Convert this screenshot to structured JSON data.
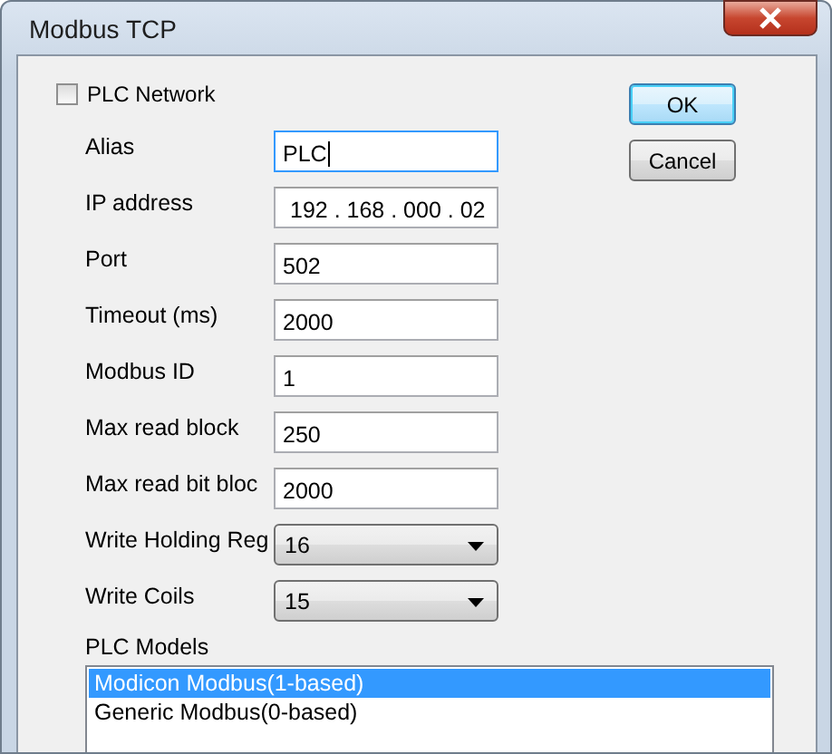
{
  "window": {
    "title": "Modbus TCP"
  },
  "plc_network": {
    "label": "PLC Network",
    "checked": false
  },
  "fields": [
    {
      "label": "Alias",
      "kind": "text",
      "value": "PLC",
      "focused": true
    },
    {
      "label": "IP address",
      "kind": "ip",
      "value": "192 . 168 . 000 . 02",
      "focused": false
    },
    {
      "label": "Port",
      "kind": "text",
      "value": "502",
      "focused": false
    },
    {
      "label": "Timeout (ms)",
      "kind": "text",
      "value": "2000",
      "focused": false
    },
    {
      "label": "Modbus ID",
      "kind": "text",
      "value": "1",
      "focused": false
    },
    {
      "label": "Max read block",
      "kind": "text",
      "value": "250",
      "focused": false
    },
    {
      "label": "Max read bit bloc",
      "kind": "text",
      "value": "2000",
      "focused": false
    },
    {
      "label": "Write Holding Reg",
      "kind": "dropdown",
      "value": "16",
      "focused": false
    },
    {
      "label": "Write Coils",
      "kind": "dropdown",
      "value": "15",
      "focused": false
    }
  ],
  "plc_models": {
    "label": "PLC Models",
    "items": [
      {
        "label": "Modicon Modbus(1-based)",
        "selected": true
      },
      {
        "label": "Generic Modbus(0-based)",
        "selected": false
      }
    ]
  },
  "buttons": [
    {
      "label": "OK",
      "default": true
    },
    {
      "label": "Cancel",
      "default": false
    }
  ]
}
